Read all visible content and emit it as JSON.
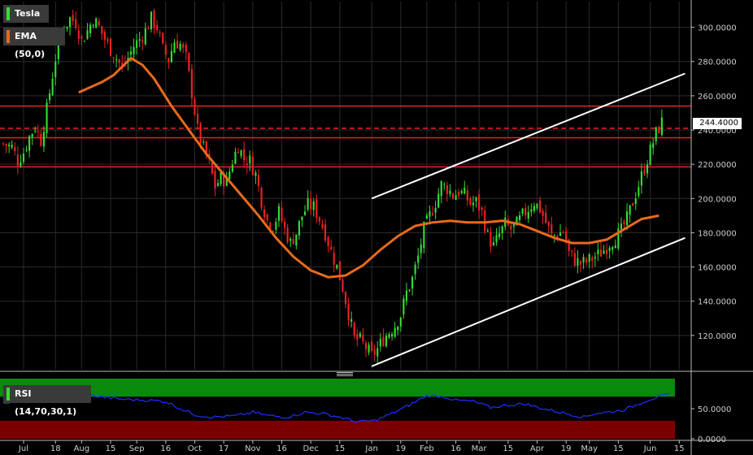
{
  "legend": {
    "symbol": "Tesla",
    "ema": "EMA (50,0)",
    "rsi": "RSI (14,70,30,1)"
  },
  "colors": {
    "background": "#000000",
    "up": "#33dd33",
    "down": "#ee2222",
    "ema": "#e86a1c",
    "level": "#ee2222",
    "channel": "#ffffff",
    "rsi_line": "#1f2fff",
    "rsi_overbought": "#0a8a0a",
    "rsi_oversold": "#7a0000",
    "grid": "#2b2b2b"
  },
  "chart_data": [
    {
      "type": "candlestick",
      "title": "Tesla",
      "ylim": [
        100,
        315
      ],
      "yticks": [
        "120.0000",
        "140.0000",
        "160.0000",
        "180.0000",
        "200.0000",
        "220.0000",
        "240.0000",
        "260.0000",
        "280.0000",
        "300.0000"
      ],
      "ytick_values": [
        120,
        140,
        160,
        180,
        200,
        220,
        240,
        260,
        280,
        300
      ],
      "xticks": [
        "Jul",
        "18",
        "Aug",
        "15",
        "Sep",
        "16",
        "Oct",
        "17",
        "Nov",
        "16",
        "Dec",
        "15",
        "Jan",
        "19",
        "Feb",
        "16",
        "Mar",
        "15",
        "Apr",
        "19",
        "May",
        "15",
        "Jun",
        "15"
      ],
      "xtick_positions": [
        7,
        18,
        27,
        37,
        46,
        56,
        66,
        76,
        86,
        96,
        106,
        116,
        127,
        137,
        146,
        156,
        164,
        174,
        184,
        194,
        202,
        212,
        223,
        233
      ],
      "last_price": "244.4000",
      "price_path_anchors": [
        [
          0,
          232
        ],
        [
          3,
          230
        ],
        [
          5,
          222
        ],
        [
          7,
          227
        ],
        [
          9,
          236
        ],
        [
          11,
          242
        ],
        [
          13,
          234
        ],
        [
          15,
          252
        ],
        [
          17,
          272
        ],
        [
          19,
          292
        ],
        [
          21,
          300
        ],
        [
          23,
          305
        ],
        [
          25,
          303
        ],
        [
          27,
          292
        ],
        [
          29,
          298
        ],
        [
          31,
          305
        ],
        [
          33,
          300
        ],
        [
          35,
          293
        ],
        [
          37,
          287
        ],
        [
          39,
          282
        ],
        [
          41,
          276
        ],
        [
          43,
          282
        ],
        [
          45,
          289
        ],
        [
          47,
          293
        ],
        [
          49,
          298
        ],
        [
          51,
          305
        ],
        [
          53,
          300
        ],
        [
          55,
          287
        ],
        [
          57,
          281
        ],
        [
          59,
          292
        ],
        [
          61,
          290
        ],
        [
          63,
          282
        ],
        [
          65,
          262
        ],
        [
          67,
          240
        ],
        [
          69,
          229
        ],
        [
          71,
          220
        ],
        [
          73,
          207
        ],
        [
          75,
          212
        ],
        [
          77,
          210
        ],
        [
          79,
          222
        ],
        [
          81,
          231
        ],
        [
          83,
          223
        ],
        [
          85,
          222
        ],
        [
          87,
          214
        ],
        [
          89,
          199
        ],
        [
          91,
          187
        ],
        [
          93,
          184
        ],
        [
          95,
          192
        ],
        [
          97,
          182
        ],
        [
          99,
          174
        ],
        [
          101,
          180
        ],
        [
          103,
          190
        ],
        [
          105,
          196
        ],
        [
          107,
          195
        ],
        [
          109,
          188
        ],
        [
          111,
          180
        ],
        [
          113,
          169
        ],
        [
          115,
          160
        ],
        [
          117,
          148
        ],
        [
          119,
          133
        ],
        [
          121,
          118
        ],
        [
          123,
          117
        ],
        [
          125,
          113
        ],
        [
          127,
          108
        ],
        [
          129,
          112
        ],
        [
          131,
          118
        ],
        [
          133,
          122
        ],
        [
          135,
          126
        ],
        [
          137,
          132
        ],
        [
          139,
          145
        ],
        [
          141,
          153
        ],
        [
          143,
          166
        ],
        [
          145,
          182
        ],
        [
          147,
          190
        ],
        [
          149,
          198
        ],
        [
          151,
          208
        ],
        [
          153,
          206
        ],
        [
          155,
          202
        ],
        [
          157,
          204
        ],
        [
          159,
          202
        ],
        [
          161,
          197
        ],
        [
          163,
          198
        ],
        [
          165,
          192
        ],
        [
          167,
          178
        ],
        [
          169,
          172
        ],
        [
          171,
          179
        ],
        [
          173,
          185
        ],
        [
          175,
          182
        ],
        [
          177,
          185
        ],
        [
          179,
          190
        ],
        [
          181,
          194
        ],
        [
          183,
          198
        ],
        [
          185,
          194
        ],
        [
          187,
          186
        ],
        [
          189,
          178
        ],
        [
          191,
          179
        ],
        [
          193,
          181
        ],
        [
          195,
          168
        ],
        [
          197,
          164
        ],
        [
          199,
          162
        ],
        [
          201,
          163
        ],
        [
          203,
          165
        ],
        [
          205,
          167
        ],
        [
          207,
          170
        ],
        [
          209,
          174
        ],
        [
          211,
          177
        ],
        [
          213,
          181
        ],
        [
          215,
          188
        ],
        [
          217,
          198
        ],
        [
          219,
          208
        ],
        [
          221,
          218
        ],
        [
          223,
          228
        ],
        [
          225,
          238
        ],
        [
          227,
          244.4
        ]
      ],
      "ema": {
        "name": "EMA (50,0)",
        "anchors": [
          [
            26,
            262
          ],
          [
            34,
            268
          ],
          [
            38,
            272
          ],
          [
            44,
            282
          ],
          [
            48,
            278
          ],
          [
            52,
            270
          ],
          [
            58,
            254
          ],
          [
            64,
            240
          ],
          [
            70,
            226
          ],
          [
            76,
            214
          ],
          [
            82,
            202
          ],
          [
            88,
            190
          ],
          [
            94,
            177
          ],
          [
            100,
            166
          ],
          [
            106,
            158
          ],
          [
            112,
            154
          ],
          [
            118,
            155
          ],
          [
            124,
            161
          ],
          [
            130,
            170
          ],
          [
            136,
            178
          ],
          [
            142,
            184
          ],
          [
            148,
            186
          ],
          [
            154,
            187
          ],
          [
            160,
            186
          ],
          [
            166,
            186
          ],
          [
            172,
            187
          ],
          [
            178,
            185
          ],
          [
            184,
            181
          ],
          [
            190,
            177
          ],
          [
            196,
            174
          ],
          [
            202,
            174
          ],
          [
            208,
            176
          ],
          [
            214,
            182
          ],
          [
            220,
            188
          ],
          [
            226,
            190
          ]
        ]
      },
      "horizontal_levels": [
        {
          "value": 254,
          "style": "solid"
        },
        {
          "value": 241,
          "style": "dashed"
        },
        {
          "value": 235.5,
          "style": "solid"
        },
        {
          "value": 218.5,
          "style": "solid"
        }
      ],
      "channel_lines": [
        {
          "from": [
            127,
            200
          ],
          "to": [
            235,
            273
          ]
        },
        {
          "from": [
            127,
            102
          ],
          "to": [
            235,
            177
          ]
        }
      ]
    },
    {
      "type": "line",
      "title": "RSI (14,70,30,1)",
      "ylim": [
        0,
        100
      ],
      "yticks": [
        "50.0000",
        "0.0000"
      ],
      "ytick_values": [
        50,
        0
      ],
      "overbought": 70,
      "oversold": 30,
      "rsi_anchors": [
        [
          0,
          60
        ],
        [
          10,
          66
        ],
        [
          20,
          74
        ],
        [
          30,
          72
        ],
        [
          40,
          66
        ],
        [
          50,
          64
        ],
        [
          56,
          62
        ],
        [
          62,
          48
        ],
        [
          66,
          40
        ],
        [
          72,
          36
        ],
        [
          80,
          38
        ],
        [
          86,
          44
        ],
        [
          92,
          38
        ],
        [
          98,
          36
        ],
        [
          104,
          44
        ],
        [
          110,
          42
        ],
        [
          116,
          36
        ],
        [
          122,
          28
        ],
        [
          128,
          30
        ],
        [
          134,
          42
        ],
        [
          140,
          56
        ],
        [
          146,
          72
        ],
        [
          152,
          70
        ],
        [
          156,
          64
        ],
        [
          162,
          62
        ],
        [
          168,
          52
        ],
        [
          174,
          56
        ],
        [
          180,
          58
        ],
        [
          186,
          50
        ],
        [
          190,
          46
        ],
        [
          196,
          40
        ],
        [
          200,
          36
        ],
        [
          204,
          42
        ],
        [
          208,
          44
        ],
        [
          214,
          48
        ],
        [
          218,
          56
        ],
        [
          222,
          64
        ],
        [
          226,
          70
        ],
        [
          230,
          74
        ]
      ]
    }
  ]
}
